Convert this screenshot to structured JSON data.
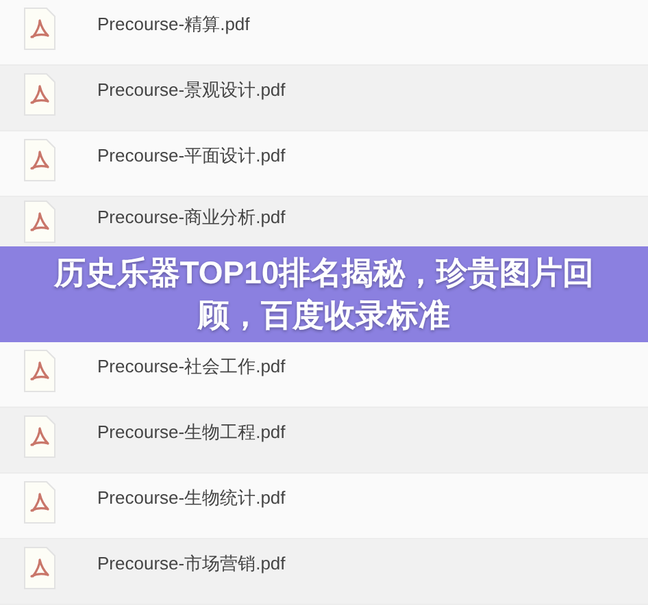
{
  "files": [
    {
      "name": "Precourse-精算.pdf"
    },
    {
      "name": "Precourse-景观设计.pdf"
    },
    {
      "name": "Precourse-平面设计.pdf"
    },
    {
      "name": "Precourse-商业分析.pdf"
    },
    {
      "name": "Precourse-社会工作.pdf"
    },
    {
      "name": "Precourse-生物工程.pdf"
    },
    {
      "name": "Precourse-生物统计.pdf"
    },
    {
      "name": "Precourse-市场营销.pdf"
    }
  ],
  "banner": {
    "title": "历史乐器TOP10排名揭秘，珍贵图片回顾，百度收录标准"
  }
}
